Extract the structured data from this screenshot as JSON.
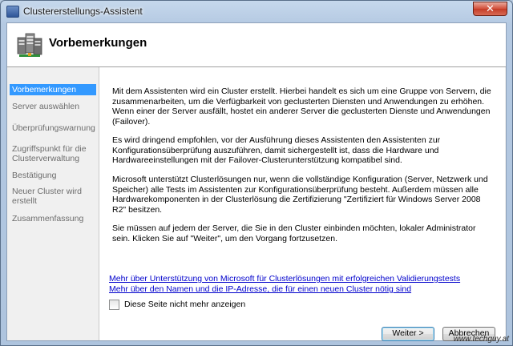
{
  "window": {
    "title": "Clustererstellungs-Assistent",
    "close_symbol": "✕"
  },
  "header": {
    "title": "Vorbemerkungen",
    "icon": "cluster-servers-icon"
  },
  "sidebar": {
    "items": [
      {
        "label": "Vorbemerkungen",
        "active": true
      },
      {
        "label": "Server auswählen",
        "active": false
      },
      {
        "label": "Überprüfungswarnung",
        "active": false
      },
      {
        "label": "Zugriffspunkt für die Clusterverwaltung",
        "active": false
      },
      {
        "label": "Bestätigung",
        "active": false
      },
      {
        "label": "Neuer Cluster wird erstellt",
        "active": false
      },
      {
        "label": "Zusammenfassung",
        "active": false
      }
    ]
  },
  "content": {
    "paragraphs": [
      "Mit dem Assistenten wird ein Cluster erstellt. Hierbei handelt es sich um eine Gruppe von Servern, die zusammenarbeiten, um die Verfügbarkeit von geclusterten Diensten und Anwendungen zu erhöhen. Wenn einer der Server ausfällt, hostet ein anderer Server die geclusterten Dienste und Anwendungen (Failover).",
      "Es wird dringend empfohlen, vor der Ausführung dieses Assistenten den Assistenten zur Konfigurationsüberprüfung auszuführen, damit sichergestellt ist, dass die Hardware und Hardwareeinstellungen mit der Failover-Clusterunterstützung kompatibel sind.",
      "Microsoft unterstützt Clusterlösungen nur, wenn die vollständige Konfiguration (Server, Netzwerk und Speicher) alle Tests im Assistenten zur Konfigurationsüberprüfung besteht. Außerdem müssen alle Hardwarekomponenten in der Clusterlösung die Zertifizierung \"Zertifiziert für Windows Server 2008 R2\" besitzen.",
      "Sie müssen auf jedem der Server, die Sie in den Cluster einbinden möchten, lokaler Administrator sein. Klicken Sie auf \"Weiter\", um den Vorgang fortzusetzen."
    ],
    "links": [
      "Mehr über Unterstützung von Microsoft für Clusterlösungen mit erfolgreichen Validierungstests",
      "Mehr über den Namen und die IP-Adresse, die für einen neuen Cluster nötig sind"
    ],
    "checkbox_label": "Diese Seite nicht mehr anzeigen",
    "checkbox_checked": false
  },
  "buttons": {
    "next": "Weiter >",
    "cancel": "Abbrechen"
  },
  "watermark": "www.techguy.at",
  "colors": {
    "selection": "#3399ff",
    "link": "#0000cc"
  }
}
